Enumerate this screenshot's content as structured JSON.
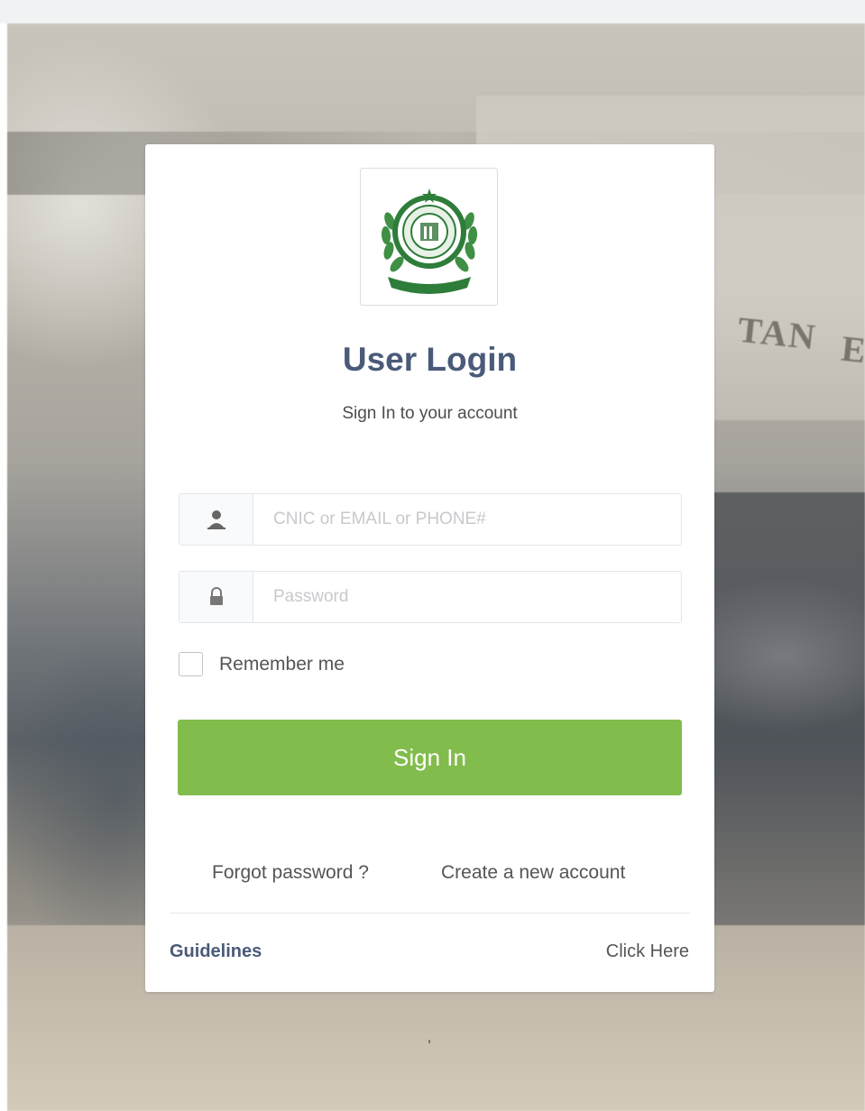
{
  "login": {
    "title": "User Login",
    "subtitle": "Sign In to your account",
    "username": {
      "placeholder": "CNIC or EMAIL or PHONE#",
      "value": "",
      "icon": "user-icon"
    },
    "password": {
      "placeholder": "Password",
      "value": "",
      "icon": "lock-icon"
    },
    "remember_label": "Remember me",
    "remember_checked": false,
    "signin_label": "Sign In",
    "forgot_label": "Forgot password ?",
    "create_label": "Create a new account",
    "guidelines_label": "Guidelines",
    "click_here_label": "Click Here"
  },
  "background_text": [
    "TAN",
    "E"
  ],
  "colors": {
    "signin_button": "#82bc4c",
    "title": "#4a5a78",
    "emblem_green": "#2e7d3a"
  }
}
